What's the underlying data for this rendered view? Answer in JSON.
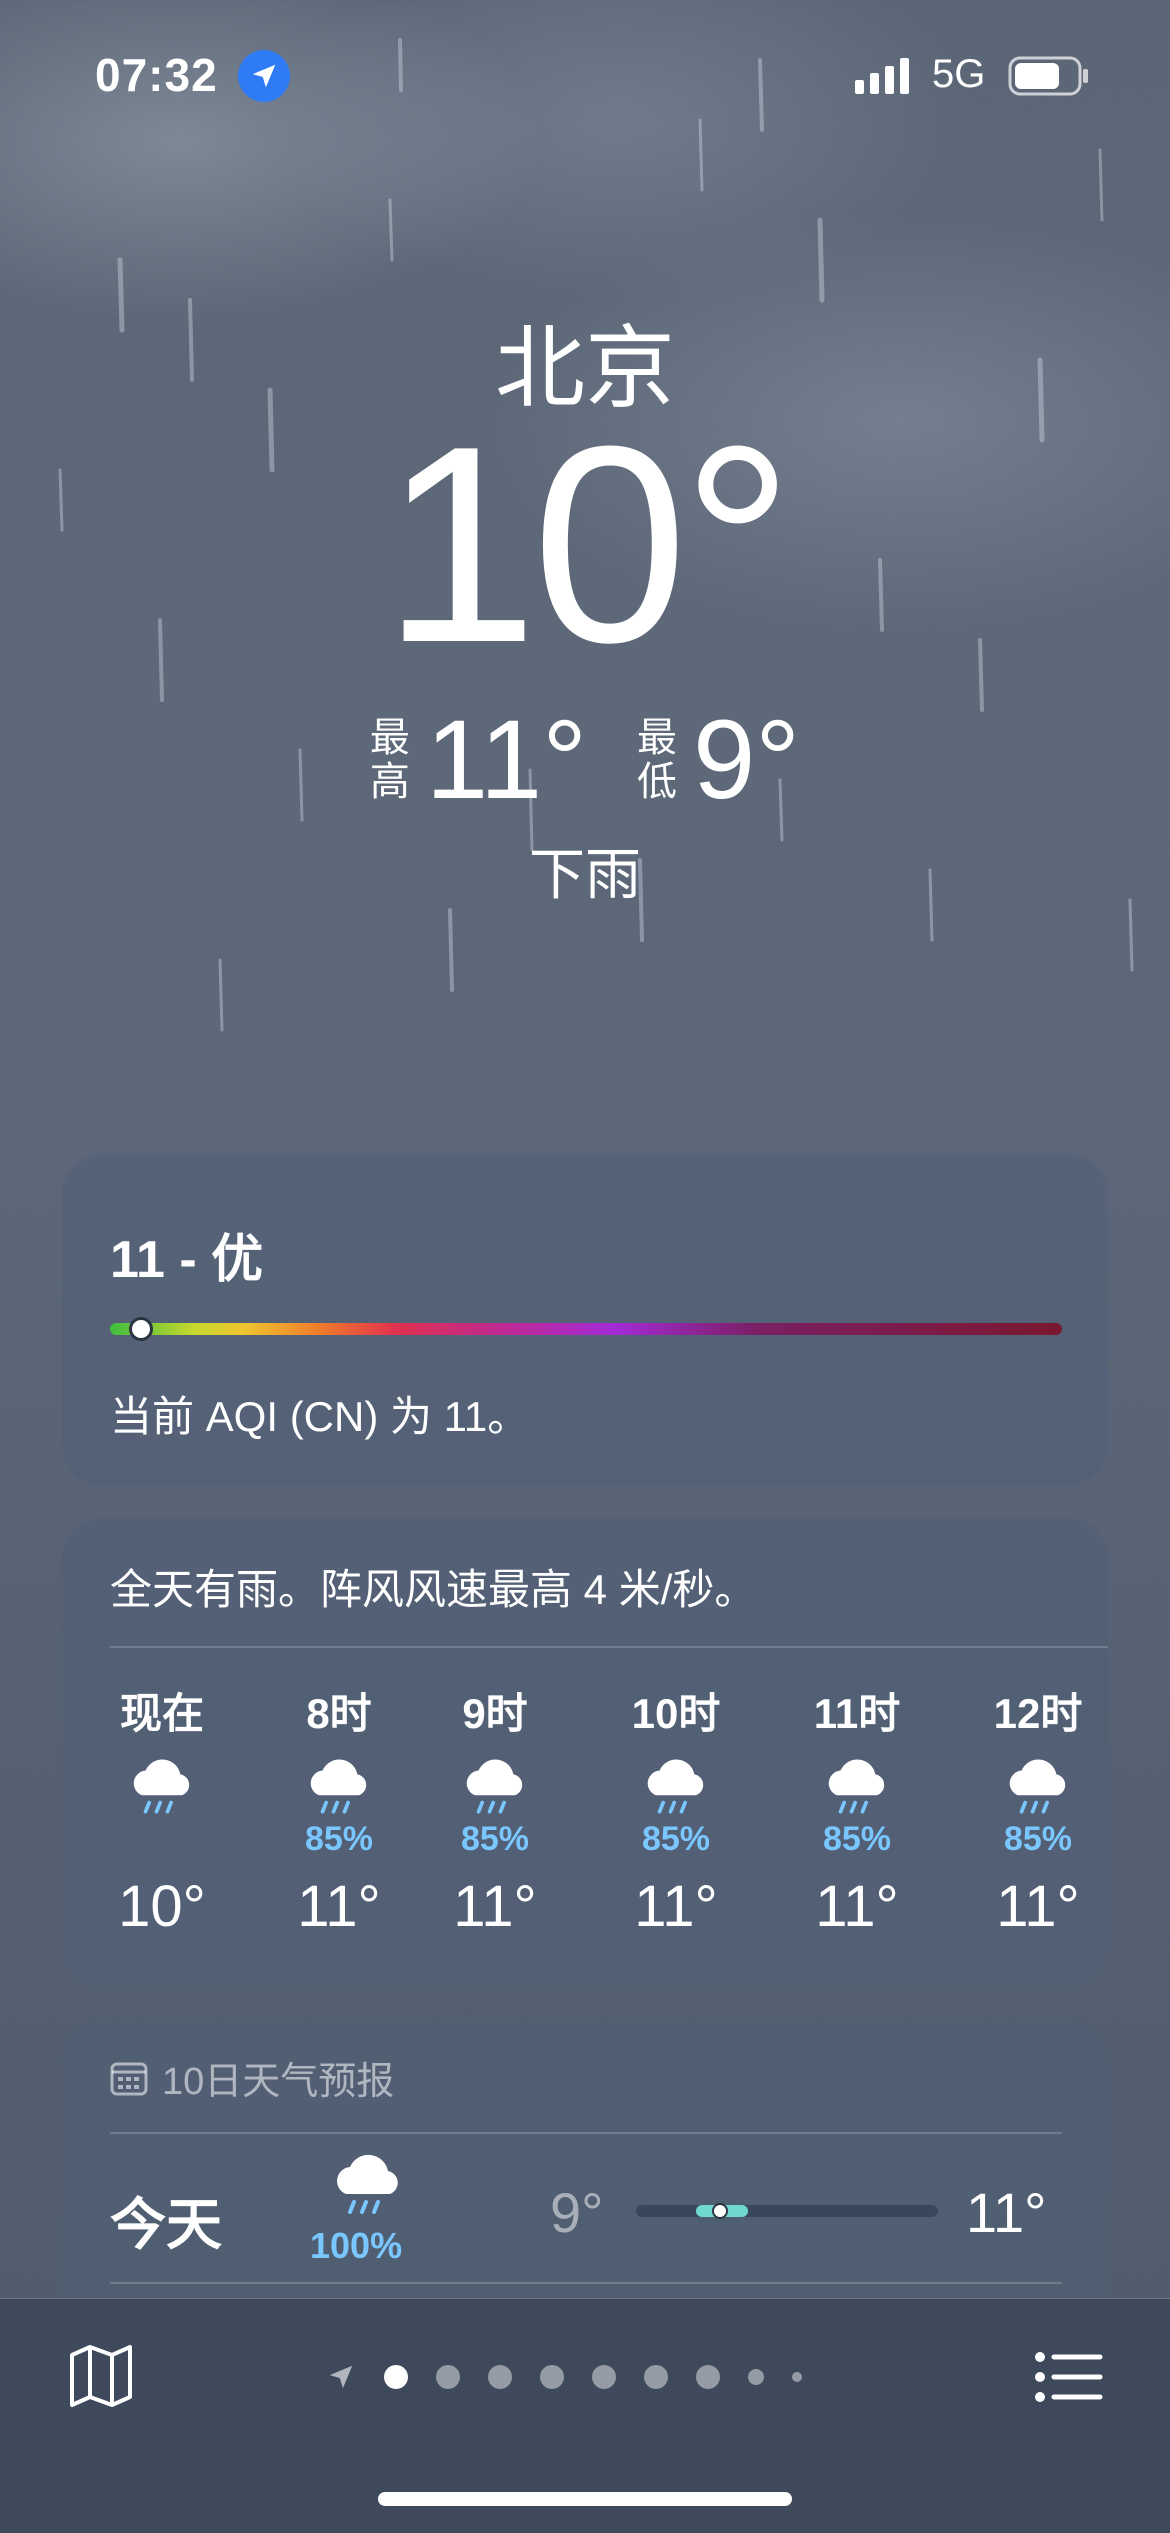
{
  "status_bar": {
    "time": "07:32",
    "network": "5G"
  },
  "current": {
    "city": "北京",
    "temperature": "10°",
    "high_label": "最高",
    "high": "11°",
    "low_label": "最低",
    "low": "9°",
    "condition": "下雨"
  },
  "aqi": {
    "value_text": "11 - 优",
    "level_fraction": 0.02,
    "description": "当前 AQI (CN) 为 11。"
  },
  "hourly": {
    "summary": "全天有雨。阵风风速最高 4 米/秒。",
    "items": [
      {
        "label": "现在",
        "pop": "",
        "temp": "10°",
        "icon": "rain-cloud-icon"
      },
      {
        "label": "8时",
        "pop": "85%",
        "temp": "11°",
        "icon": "rain-cloud-icon"
      },
      {
        "label": "9时",
        "pop": "85%",
        "temp": "11°",
        "icon": "rain-cloud-icon"
      },
      {
        "label": "10时",
        "pop": "85%",
        "temp": "11°",
        "icon": "rain-cloud-icon"
      },
      {
        "label": "11时",
        "pop": "85%",
        "temp": "11°",
        "icon": "rain-cloud-icon"
      },
      {
        "label": "12时",
        "pop": "85%",
        "temp": "11°",
        "icon": "rain-cloud-icon"
      }
    ]
  },
  "daily": {
    "header": "10日天气预报",
    "rows": [
      {
        "day": "今天",
        "pop": "100%",
        "low": "9°",
        "high": "11°",
        "icon": "rain-cloud-icon"
      }
    ]
  },
  "toolbar": {
    "pages": 9,
    "active_page": 0,
    "icons": [
      "map-icon",
      "location-arrow-icon",
      "list-icon"
    ]
  }
}
